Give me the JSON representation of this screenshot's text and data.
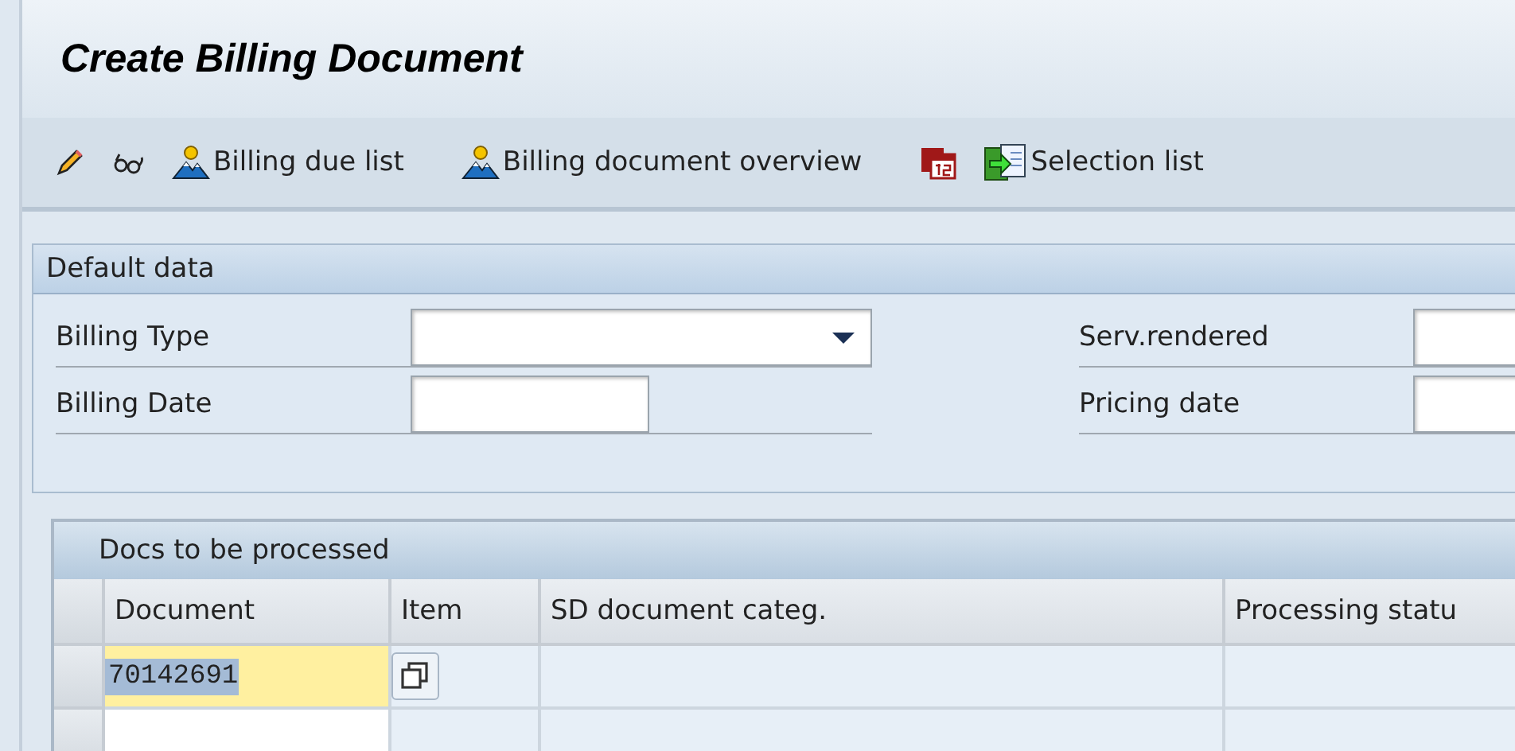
{
  "window": {
    "title": "Create Billing Document"
  },
  "toolbar": [
    {
      "kind": "pencil"
    },
    {
      "kind": "glasses"
    },
    {
      "kind": "person",
      "label": "Billing due list"
    },
    {
      "kind": "person",
      "label": "Billing document overview"
    },
    {
      "kind": "calendar"
    },
    {
      "kind": "selection",
      "label": "Selection list"
    }
  ],
  "default_data": {
    "title": "Default data",
    "left_fields": [
      {
        "label": "Billing Type",
        "kind": "dropdown"
      },
      {
        "label": "Billing Date",
        "kind": "date"
      }
    ],
    "right_fields": [
      {
        "label": "Serv.rendered",
        "kind": "date"
      },
      {
        "label": "Pricing date",
        "kind": "date"
      }
    ]
  },
  "docs_table": {
    "title": "Docs to be processed",
    "columns": [
      "Document",
      "Item",
      "SD document categ.",
      "Processing statu"
    ],
    "rows": [
      {
        "document": "70142691",
        "focused": true
      },
      {
        "focused": false
      }
    ]
  }
}
